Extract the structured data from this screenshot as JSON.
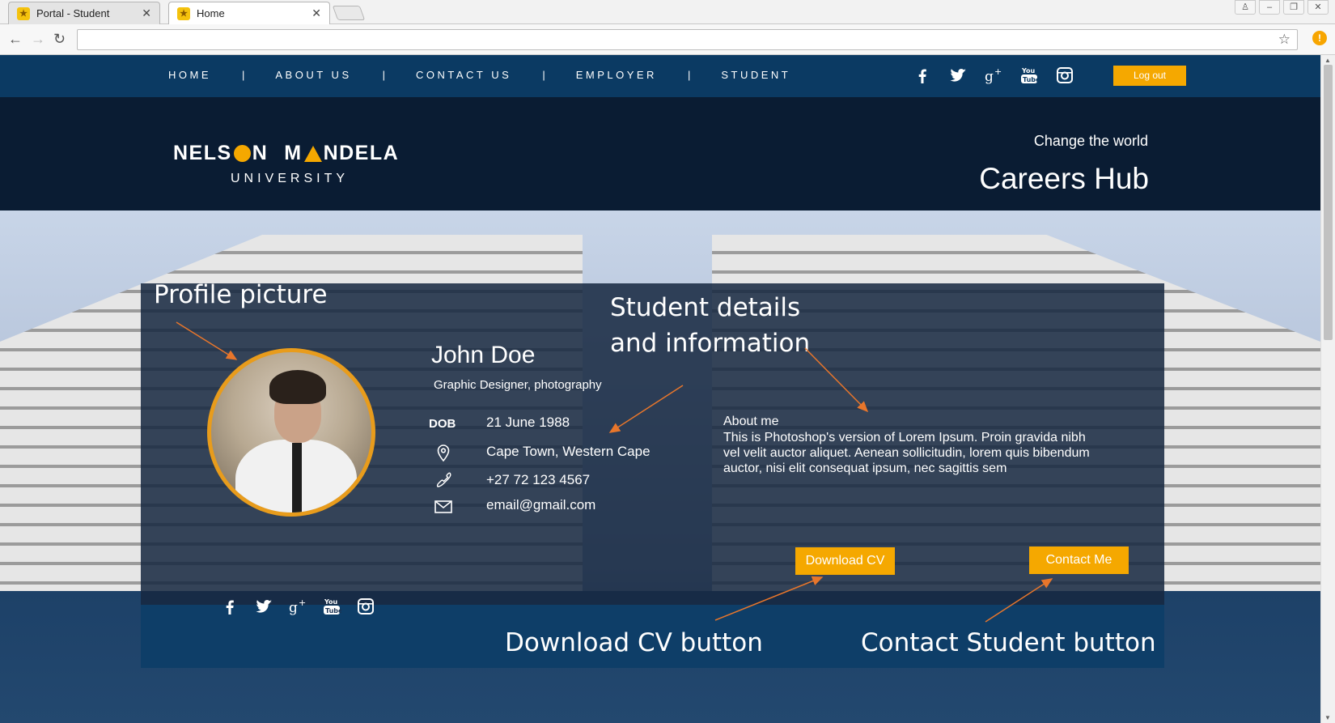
{
  "browser": {
    "tabs": [
      {
        "title": "Portal - Student",
        "active": false
      },
      {
        "title": "Home",
        "active": true
      }
    ],
    "address": ""
  },
  "nav": {
    "links": [
      "HOME",
      "ABOUT US",
      "CONTACT US",
      "EMPLOYER",
      "STUDENT"
    ],
    "separator": "|",
    "logout_label": "Log out"
  },
  "brand": {
    "logo_word1_a": "NELS",
    "logo_word1_b": "N",
    "logo_word2_a": "M",
    "logo_word2_b": "NDELA",
    "logo_sub": "UNIVERSITY",
    "tagline": "Change the world",
    "title": "Careers Hub"
  },
  "profile": {
    "name": "John Doe",
    "role": "Graphic Designer, photography",
    "dob_label": "DOB",
    "dob": "21 June 1988",
    "location": "Cape Town, Western Cape",
    "phone": "+27 72 123 4567",
    "email": "email@gmail.com",
    "about_heading": "About me",
    "about_text": "This is Photoshop's version  of Lorem Ipsum. Proin gravida nibh vel velit auctor aliquet. Aenean sollicitudin, lorem quis bibendum auctor, nisi elit consequat ipsum, nec sagittis sem",
    "download_label": "Download CV",
    "contact_label": "Contact Me"
  },
  "annotations": {
    "profile_picture": "Profile picture",
    "details_line1": "Student details",
    "details_line2": "and information",
    "download_cv": "Download CV button",
    "contact_student": "Contact Student button"
  },
  "colors": {
    "accent": "#f5a800",
    "nav_bg": "#0b3a63",
    "brand_bg": "#0a1c33",
    "arrow": "#e8762b"
  },
  "icons": {
    "social": [
      "facebook-icon",
      "twitter-icon",
      "google-plus-icon",
      "youtube-icon",
      "instagram-icon"
    ]
  }
}
